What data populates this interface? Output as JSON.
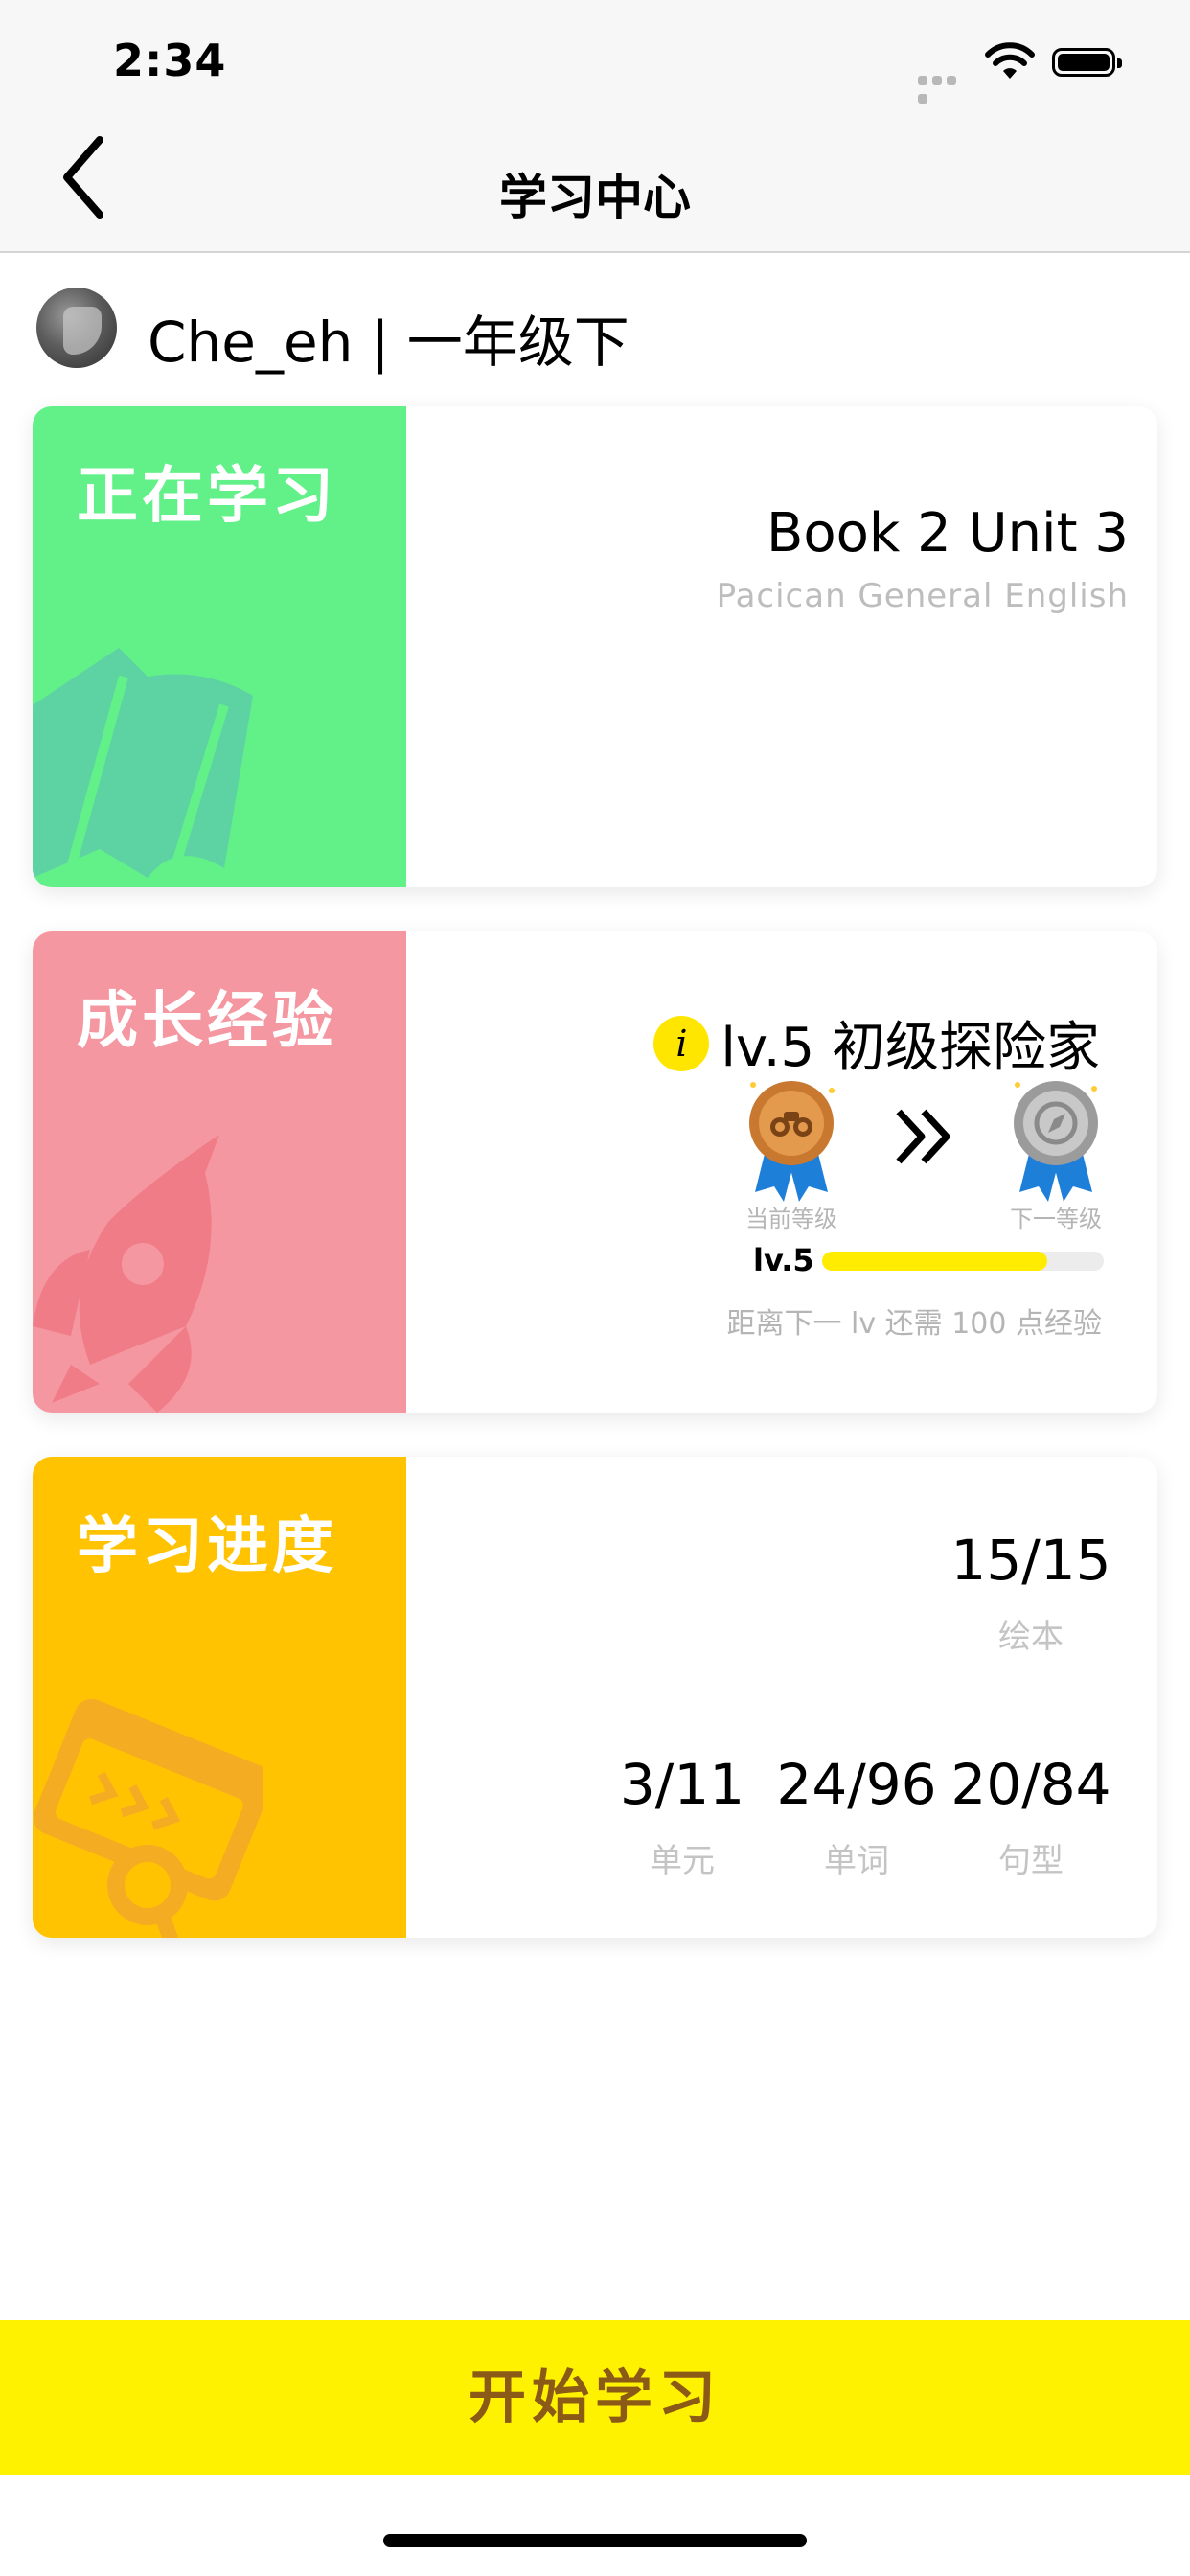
{
  "status_bar": {
    "time": "2:34"
  },
  "nav": {
    "title": "学习中心"
  },
  "user": {
    "name": "Che_eh | 一年级下"
  },
  "cards": {
    "learning": {
      "title": "正在学习",
      "book": "Book 2 Unit 3",
      "course": "Pacican General English"
    },
    "growth": {
      "title": "成长经验",
      "level_title": "lv.5 初级探险家",
      "current_label": "当前等级",
      "next_label": "下一等级",
      "level": "lv.5",
      "progress": 0.8,
      "need_text": "距离下一 lv 还需 100 点经验"
    },
    "progress": {
      "title": "学习进度",
      "stats": {
        "picture_books": {
          "value": "15/15",
          "label": "绘本"
        },
        "units": {
          "value": "3/11",
          "label": "单元"
        },
        "words": {
          "value": "24/96",
          "label": "单词"
        },
        "sentences": {
          "value": "20/84",
          "label": "句型"
        }
      }
    }
  },
  "actions": {
    "start": "开始学习"
  },
  "colors": {
    "learning": "#62f188",
    "growth": "#f597a1",
    "progress": "#ffc302",
    "button": "#fff200",
    "button_text": "#8a5a16"
  },
  "icons": [
    "back-chevron-icon",
    "wifi-icon",
    "battery-icon",
    "book-icon",
    "rocket-icon",
    "browser-search-icon",
    "info-icon",
    "bronze-medal-icon",
    "silver-medal-icon",
    "double-chevron-right-icon"
  ]
}
